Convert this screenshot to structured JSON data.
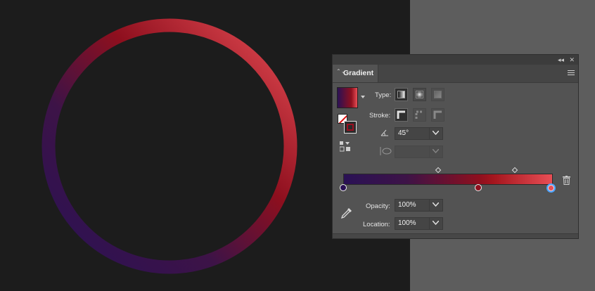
{
  "panel": {
    "title": "Gradient",
    "collapse_glyph": "◂◂",
    "close_glyph": "✕",
    "tab_arrows_glyph": "⌃⌄"
  },
  "type_row": {
    "label": "Type:"
  },
  "stroke_row": {
    "label": "Stroke:"
  },
  "angle": {
    "value": "45°"
  },
  "aspect": {
    "value": ""
  },
  "opacity": {
    "label": "Opacity:",
    "value": "100%"
  },
  "location": {
    "label": "Location:",
    "value": "100%"
  },
  "colors": {
    "gradient_start": "#2a1155",
    "gradient_mid": "#8e0f1e",
    "gradient_end": "#e84e55",
    "selected_stop_ring": "#4aa3ff",
    "panel_bg": "#535353",
    "pasteboard": "#5d5d5d",
    "artboard": "#1c1c1c"
  },
  "gradient": {
    "stops": [
      {
        "location": 0,
        "color": "#2a1155",
        "selected": false
      },
      {
        "location": 0.65,
        "color": "#8e0f1e",
        "selected": false
      },
      {
        "location": 1.0,
        "color": "#e84e55",
        "selected": true
      }
    ],
    "midpoints": [
      0.46,
      0.82
    ]
  },
  "icons": {
    "collapse": "double-chevron-left-icon",
    "close": "close-icon",
    "menu": "hamburger-menu-icon",
    "angle": "angle-icon",
    "aspect": "aspect-ratio-icon",
    "eyedropper": "eyedropper-icon",
    "delete": "trash-icon",
    "reverse": "reverse-gradient-icon"
  }
}
